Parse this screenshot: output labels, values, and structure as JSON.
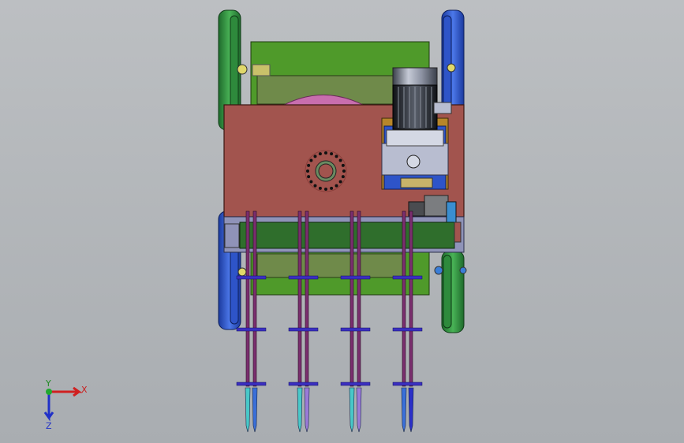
{
  "triad": {
    "x_label": "X",
    "y_label": "Y",
    "z_label": "Z"
  },
  "colors": {
    "background": "#b4b7bb",
    "frame_green": "#4f9a2a",
    "plate_red": "#a2544e",
    "wheel_green": "#2e8a3c",
    "wheel_blue": "#2e54c8",
    "motor_gray": "#9fa4b4",
    "strip_green": "#2f6e2c",
    "bit_cyan": "#48c8c8",
    "bit_violet": "#9a7ad8",
    "bit_blue": "#3f5fd6"
  }
}
